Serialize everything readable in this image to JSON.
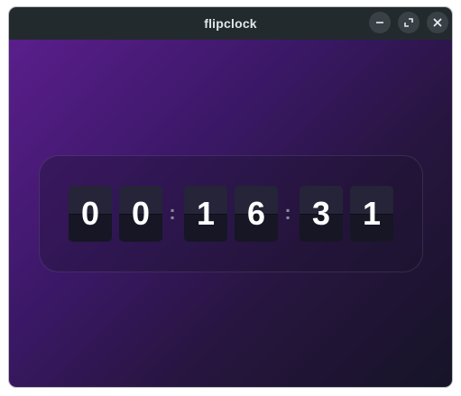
{
  "window": {
    "title": "flipclock",
    "controls": {
      "minimize_icon": "minimize-icon",
      "maximize_icon": "maximize-icon",
      "close_icon": "close-icon"
    }
  },
  "clock": {
    "hours": [
      "0",
      "0"
    ],
    "minutes": [
      "1",
      "6"
    ],
    "seconds": [
      "3",
      "1"
    ],
    "separator": ":"
  },
  "colors": {
    "titlebar": "#232a2e",
    "background_start": "#5a1e8c",
    "background_end": "#161427",
    "digit": "#ffffff"
  }
}
